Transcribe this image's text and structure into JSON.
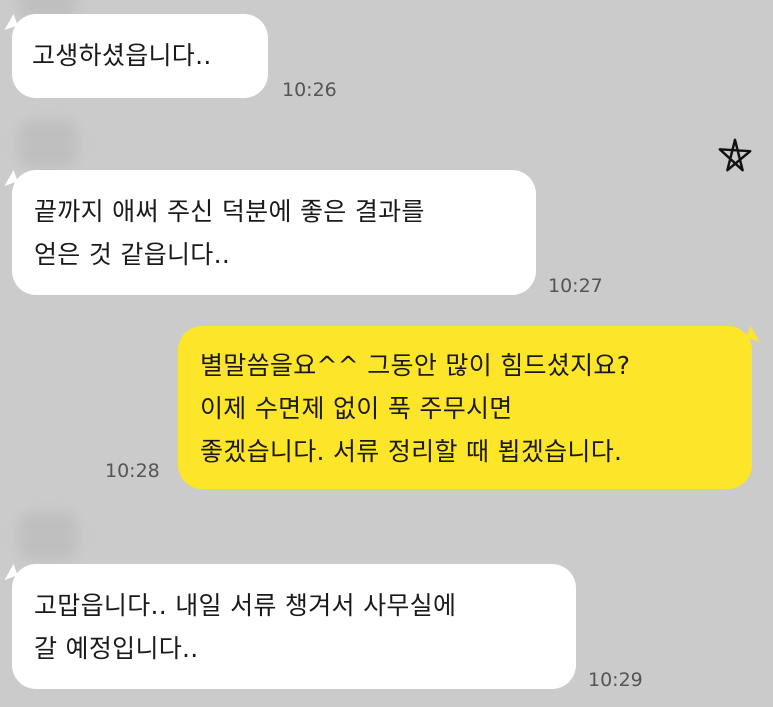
{
  "messages": [
    {
      "id": "m1",
      "direction": "incoming",
      "lines": [
        "고생하셨읍니다.."
      ],
      "time": "10:26"
    },
    {
      "id": "m2",
      "direction": "incoming",
      "lines": [
        "끝까지 애써 주신 덕분에 좋은 결과를",
        "얻은 것 같읍니다.."
      ],
      "time": "10:27"
    },
    {
      "id": "m3",
      "direction": "outgoing",
      "lines": [
        "별말씀을요^^ 그동안 많이 힘드셨지요?",
        "이제 수면제 없이 푹 주무시면",
        "좋겠습니다. 서류 정리할 때 뵙겠습니다."
      ],
      "time": "10:28"
    },
    {
      "id": "m4",
      "direction": "incoming",
      "lines": [
        "고맙읍니다.. 내일 서류 챙겨서 사무실에",
        "갈 예정입니다.."
      ],
      "time": "10:29"
    }
  ],
  "colors": {
    "background": "#cbcbcb",
    "incoming_bubble": "#ffffff",
    "outgoing_bubble": "#fde52a",
    "time_text": "#555555"
  },
  "icons": {
    "doodle": "star-icon"
  }
}
